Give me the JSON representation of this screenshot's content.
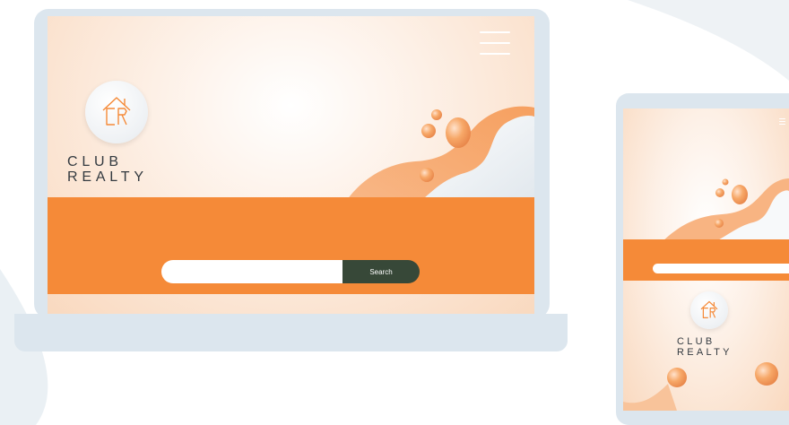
{
  "brand": {
    "line1": "CLUB",
    "line2": "REALTY",
    "logo_mark": "CR"
  },
  "search": {
    "button_label": "Search",
    "value": "",
    "placeholder": ""
  },
  "icons": {
    "menu": "hamburger-menu-icon",
    "logo": "house-logo-icon"
  },
  "colors": {
    "accent_orange": "#f58a38",
    "search_button": "#374838",
    "device_frame": "#dce6ee",
    "text_dark": "#333a40"
  }
}
